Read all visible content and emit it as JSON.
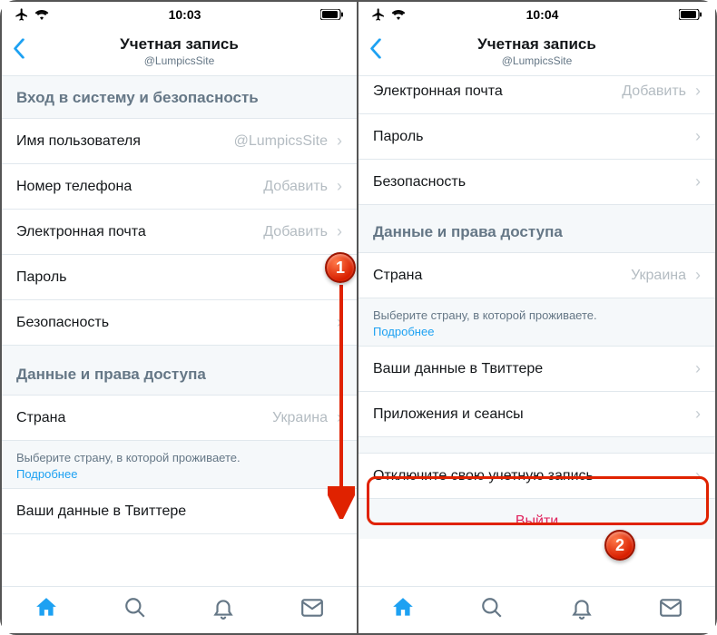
{
  "left": {
    "status": {
      "time": "10:03"
    },
    "nav": {
      "title": "Учетная запись",
      "subtitle": "@LumpicsSite"
    },
    "section_login": "Вход в систему и безопасность",
    "rows": {
      "username": {
        "label": "Имя пользователя",
        "value": "@LumpicsSite"
      },
      "phone": {
        "label": "Номер телефона",
        "value": "Добавить"
      },
      "email": {
        "label": "Электронная почта",
        "value": "Добавить"
      },
      "password": {
        "label": "Пароль"
      },
      "security": {
        "label": "Безопасность"
      }
    },
    "section_data": "Данные и права доступа",
    "country": {
      "label": "Страна",
      "value": "Украина"
    },
    "country_hint": "Выберите страну, в которой проживаете.",
    "more_link": "Подробнее",
    "your_data": {
      "label": "Ваши данные в Твиттере"
    }
  },
  "right": {
    "status": {
      "time": "10:04"
    },
    "nav": {
      "title": "Учетная запись",
      "subtitle": "@LumpicsSite"
    },
    "rows_top": {
      "email": {
        "label": "Электронная почта",
        "value": "Добавить"
      },
      "password": {
        "label": "Пароль"
      },
      "security": {
        "label": "Безопасность"
      }
    },
    "section_data": "Данные и права доступа",
    "country": {
      "label": "Страна",
      "value": "Украина"
    },
    "country_hint": "Выберите страну, в которой проживаете.",
    "more_link": "Подробнее",
    "your_data": {
      "label": "Ваши данные в Твиттере"
    },
    "apps_sessions": {
      "label": "Приложения и сеансы"
    },
    "deactivate": {
      "label": "Отключите свою учетную запись"
    },
    "logout": "Выйти"
  },
  "markers": {
    "one": "1",
    "two": "2"
  }
}
